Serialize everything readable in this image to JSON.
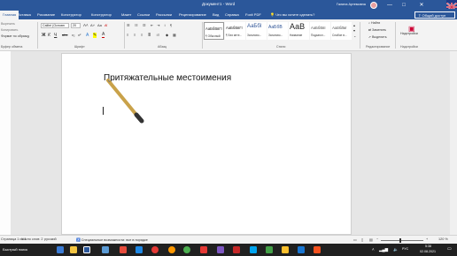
{
  "window": {
    "title": "Документ1 - Word",
    "user": "Галина Артемовна",
    "controls": [
      "—",
      "□",
      "✕"
    ]
  },
  "tabs": {
    "file": "Файл",
    "home": "Главная",
    "insert": "Вставка",
    "draw": "Рисование",
    "design": "Конструктор",
    "layout": "Макет",
    "references": "Ссылки",
    "mailings": "Рассылки",
    "review": "Рецензирование",
    "view": "Вид",
    "help": "Справка",
    "foxit": "Foxit PDF",
    "tell_me": "Что вы хотите сделать?",
    "share": "Общий доступ"
  },
  "ribbon": {
    "clipboard": {
      "cut": "Вырезать",
      "copy": "Копировать",
      "format_painter": "Формат по образцу",
      "label": "Буфер обмена"
    },
    "font": {
      "name": "Calibri (Основн",
      "size": "20",
      "label": "Шрифт"
    },
    "paragraph": {
      "label": "Абзац"
    },
    "styles": {
      "label": "Стили",
      "items": [
        {
          "preview": "АаБбВвГг",
          "name": "¶ Обычный"
        },
        {
          "preview": "АаБбВвГг",
          "name": "¶ Без инте..."
        },
        {
          "preview": "АаБбI",
          "name": "Заголово..."
        },
        {
          "preview": "АаБбВ",
          "name": "Заголово..."
        },
        {
          "preview": "АаВ",
          "name": "Название"
        },
        {
          "preview": "АаБбВвI",
          "name": "Подзагол..."
        },
        {
          "preview": "АаБбВвI",
          "name": "Слабое в..."
        }
      ]
    },
    "editing": {
      "find": "Найти",
      "replace": "Заменить",
      "select": "Выделить",
      "label": "Редактирование"
    },
    "addins": {
      "label": "Надстройки"
    }
  },
  "document": {
    "heading": "Притяжательные местоимения"
  },
  "status": {
    "page": "Страница 1 из 1",
    "words": "Число слов: 2",
    "language": "русский",
    "accessibility": "Специальные возможности: все в порядке",
    "zoom": "120 %"
  },
  "taskbar": {
    "search": "Быстрый поиск",
    "lang": "РУС",
    "time": "5:38",
    "date": "02.08.2021"
  }
}
